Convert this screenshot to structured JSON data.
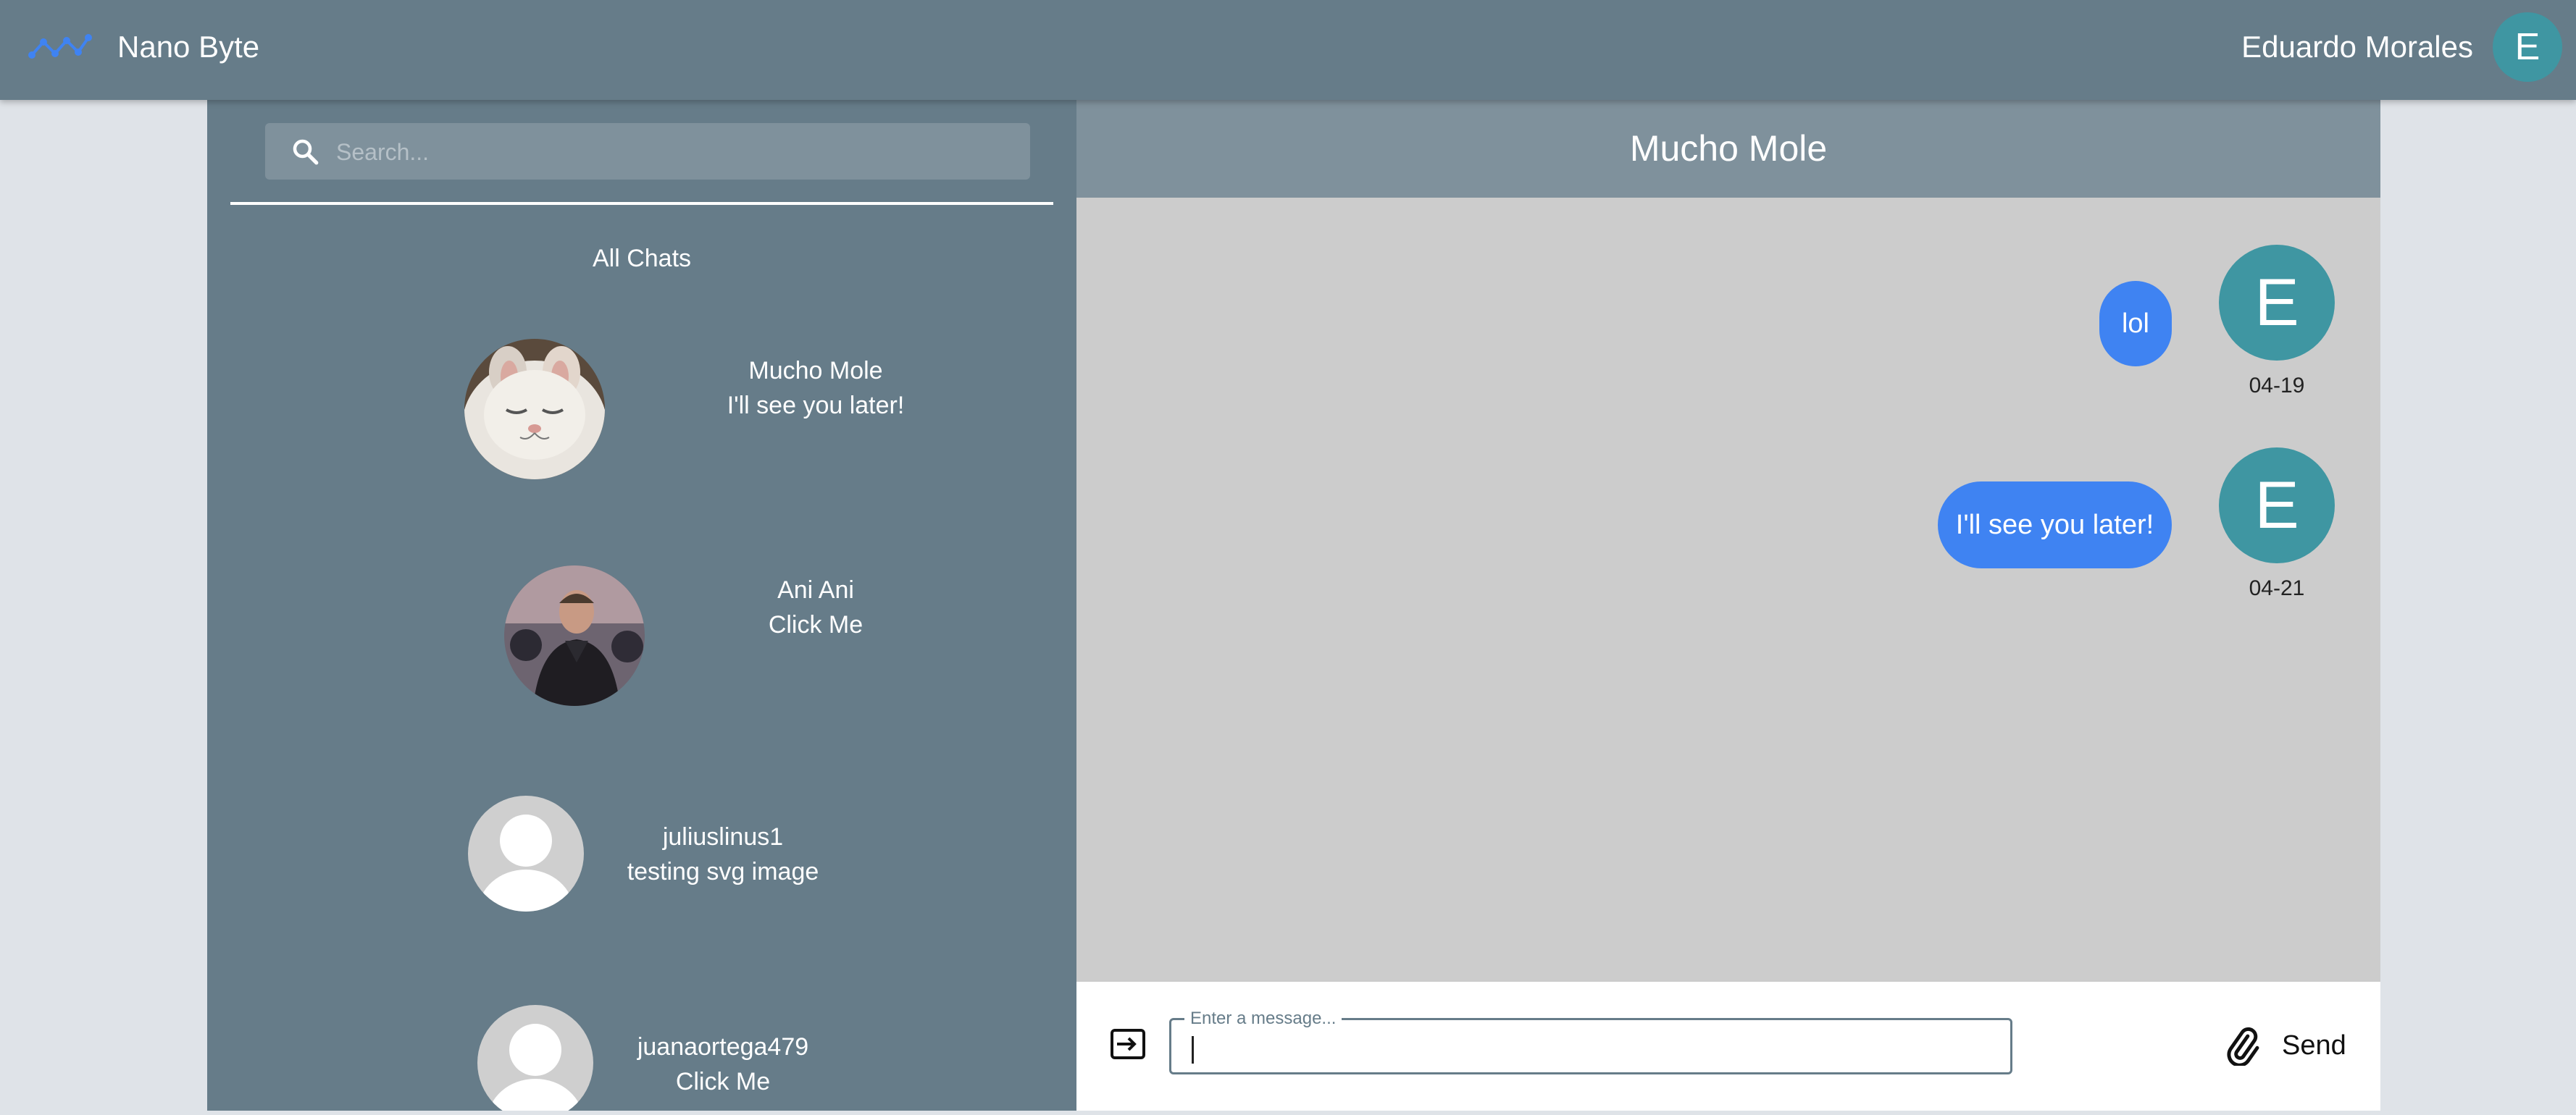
{
  "header": {
    "brand_name": "Nano Byte",
    "user_name": "Eduardo Morales",
    "user_initial": "E",
    "brand_icon": "wave-chart-icon"
  },
  "sidebar": {
    "search_placeholder": "Search...",
    "section_label": "All Chats",
    "chats": [
      {
        "name": "Mucho Mole",
        "last_message": "I'll see you later!",
        "avatar": "cat-photo"
      },
      {
        "name": "Ani Ani",
        "last_message": "Click Me",
        "avatar": "person-photo"
      },
      {
        "name": "juliuslinus1",
        "last_message": "testing svg image",
        "avatar": "default-avatar"
      },
      {
        "name": "juanaortega479",
        "last_message": "Click Me",
        "avatar": "default-avatar"
      }
    ]
  },
  "chat": {
    "title": "Mucho Mole",
    "messages": [
      {
        "text": "lol",
        "sender_initial": "E",
        "date": "04-19"
      },
      {
        "text": "I'll see you later!",
        "sender_initial": "E",
        "date": "04-21"
      }
    ],
    "composer": {
      "label": "Enter a message...",
      "value": "",
      "send_label": "Send"
    }
  },
  "colors": {
    "topbar": "#667c89",
    "sidebar": "#667c89",
    "bubble": "#3f83f2",
    "avatar": "#3f96a2",
    "chat_background": "#cccccc"
  }
}
